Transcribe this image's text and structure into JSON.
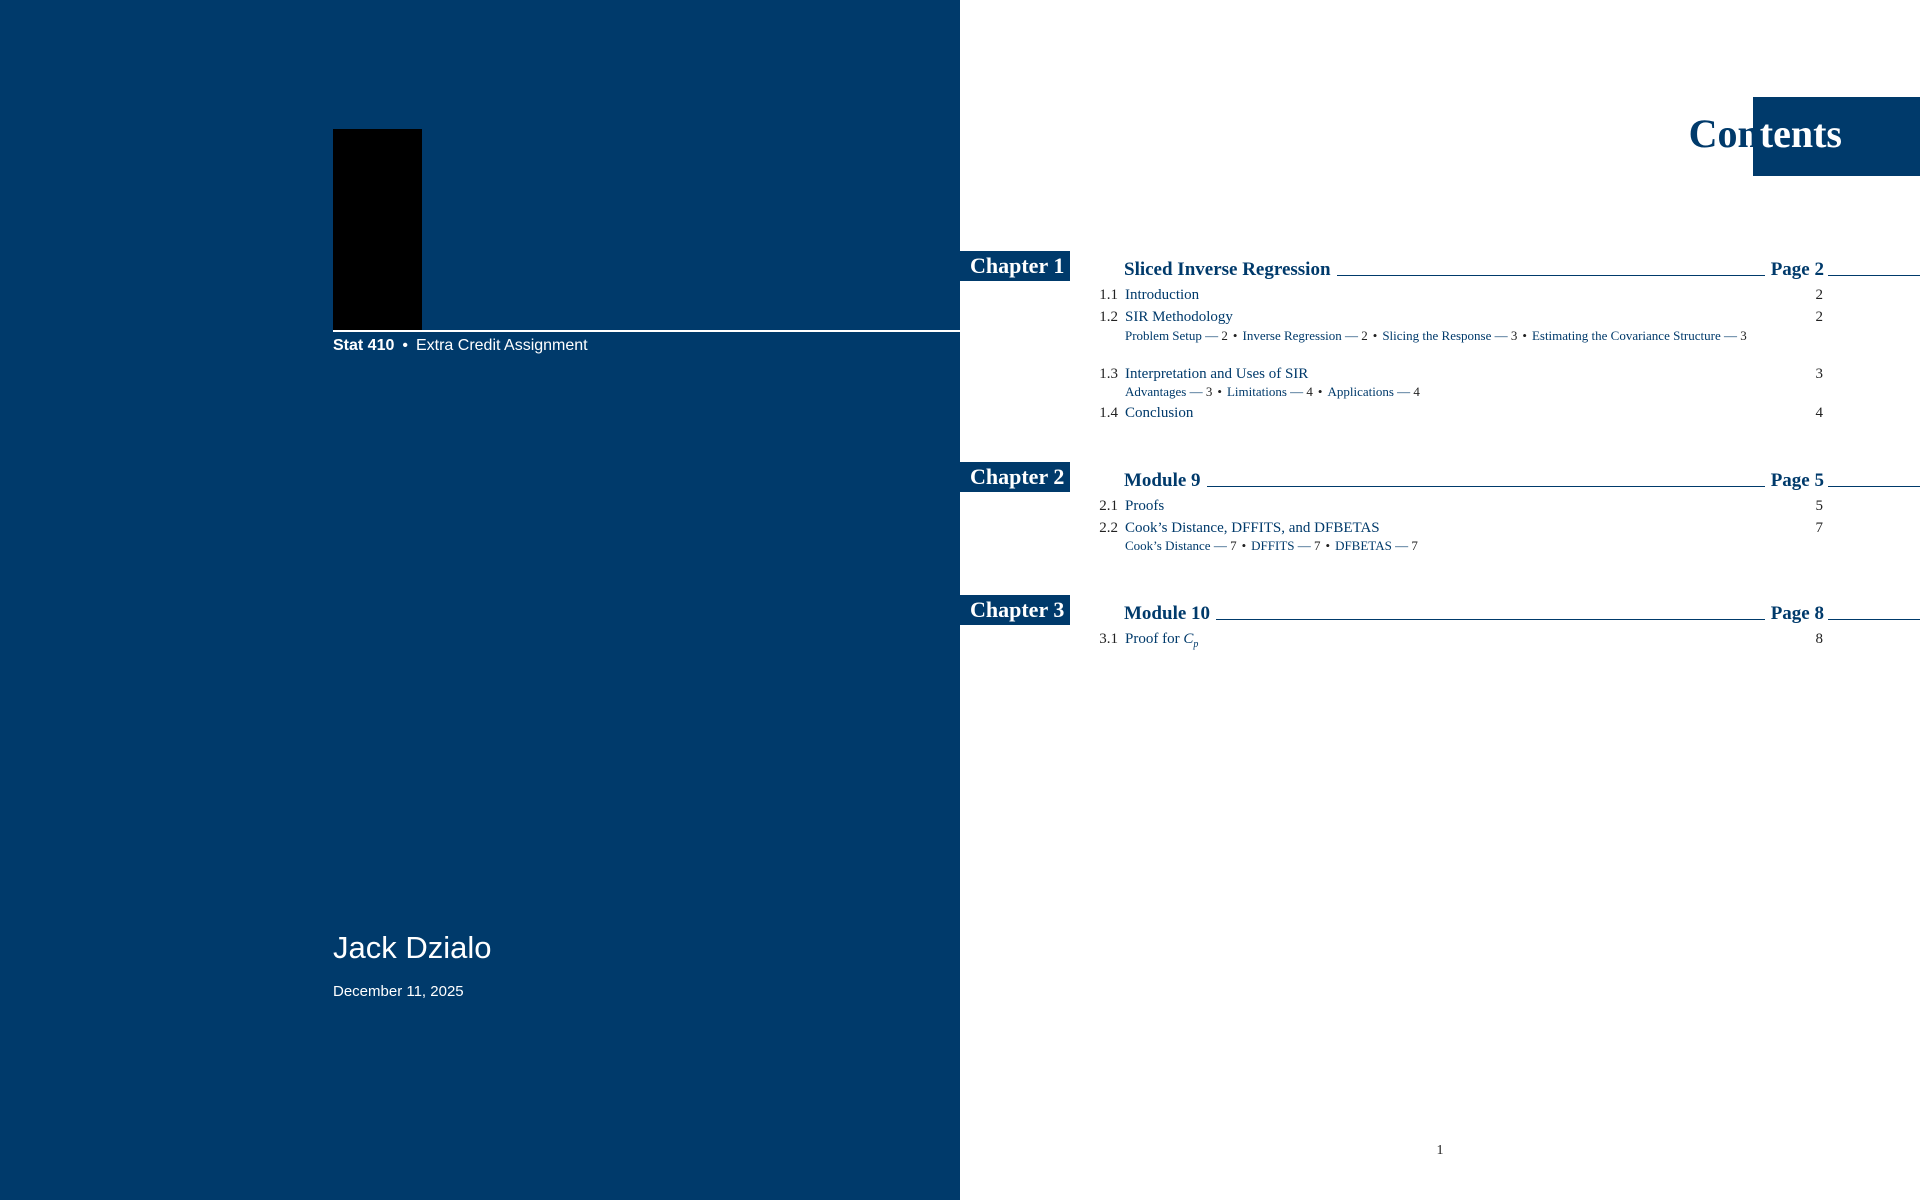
{
  "cover": {
    "course": "Stat 410",
    "separator": "•",
    "assignment": "Extra Credit Assignment",
    "author": "Jack Dzialo",
    "date": "December 11, 2025"
  },
  "contents": {
    "heading": "Contents",
    "heading_part1": "Con",
    "heading_part2": "tents",
    "page_number": "1",
    "chapters": [
      {
        "tag": "Chapter 1",
        "title": "Sliced Inverse Regression",
        "page": "Page 2",
        "sections": [
          {
            "num": "1.1",
            "title": "Introduction",
            "page": "2"
          },
          {
            "num": "1.2",
            "title": "SIR Methodology",
            "page": "2",
            "subsections": [
              {
                "title": "Problem Setup",
                "page": "2"
              },
              {
                "title": "Inverse Regression",
                "page": "2"
              },
              {
                "title": "Slicing the Response",
                "page": "3"
              },
              {
                "title": "Estimating the Covariance Structure",
                "page": "3"
              }
            ]
          },
          {
            "num": "1.3",
            "title": "Interpretation and Uses of SIR",
            "page": "3",
            "subsections": [
              {
                "title": "Advantages",
                "page": "3"
              },
              {
                "title": "Limitations",
                "page": "4"
              },
              {
                "title": "Applications",
                "page": "4"
              }
            ]
          },
          {
            "num": "1.4",
            "title": "Conclusion",
            "page": "4"
          }
        ]
      },
      {
        "tag": "Chapter 2",
        "title": "Module 9",
        "page": "Page 5",
        "sections": [
          {
            "num": "2.1",
            "title": "Proofs",
            "page": "5"
          },
          {
            "num": "2.2",
            "title": "Cook’s Distance, DFFITS, and DFBETAS",
            "page": "7",
            "subsections": [
              {
                "title": "Cook’s Distance",
                "page": "7"
              },
              {
                "title": "DFFITS",
                "page": "7"
              },
              {
                "title": "DFBETAS",
                "page": "7"
              }
            ]
          }
        ]
      },
      {
        "tag": "Chapter 3",
        "title": "Module 10",
        "page": "Page 8",
        "sections": [
          {
            "num": "3.1",
            "title": "Proof for",
            "title_math": "C",
            "title_math_sub": "p",
            "page": "8"
          }
        ]
      }
    ]
  }
}
